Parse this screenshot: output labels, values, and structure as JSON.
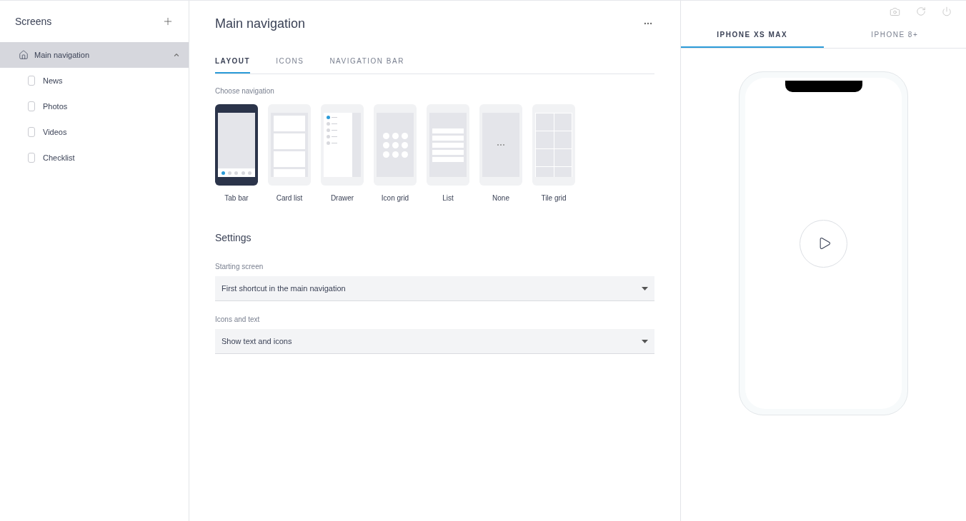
{
  "sidebar": {
    "title": "Screens",
    "items": [
      {
        "label": "Main navigation",
        "selected": true,
        "expanded": true,
        "children": [
          {
            "label": "News",
            "selected": false
          },
          {
            "label": "Photos",
            "selected": false
          },
          {
            "label": "Videos",
            "selected": false
          },
          {
            "label": "Checklist",
            "selected": false
          }
        ]
      }
    ]
  },
  "main": {
    "title": "Main navigation",
    "tabs": [
      {
        "label": "LAYOUT",
        "selected": true
      },
      {
        "label": "ICONS",
        "selected": false
      },
      {
        "label": "NAVIGATION BAR",
        "selected": false
      }
    ],
    "choose_label": "Choose navigation",
    "options": [
      {
        "kind": "tabbar",
        "label": "Tab bar",
        "selected": true
      },
      {
        "kind": "cardlist",
        "label": "Card list",
        "selected": false
      },
      {
        "kind": "drawer",
        "label": "Drawer",
        "selected": false
      },
      {
        "kind": "icongrid",
        "label": "Icon grid",
        "selected": false
      },
      {
        "kind": "list",
        "label": "List",
        "selected": false
      },
      {
        "kind": "none",
        "label": "None",
        "selected": false
      },
      {
        "kind": "tilegrid",
        "label": "Tile grid",
        "selected": false
      }
    ],
    "settings_title": "Settings",
    "fields": [
      {
        "label": "Starting screen",
        "value": "First shortcut in the main navigation"
      },
      {
        "label": "Icons and text",
        "value": "Show text and icons"
      }
    ]
  },
  "preview": {
    "tabs": [
      {
        "label": "IPHONE XS MAX",
        "selected": true
      },
      {
        "label": "IPHONE 8+",
        "selected": false
      }
    ]
  }
}
